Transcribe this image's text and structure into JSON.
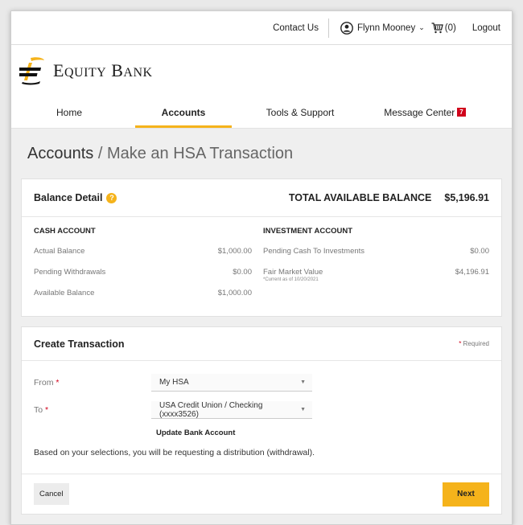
{
  "header": {
    "contact": "Contact Us",
    "user_name": "Flynn Mooney",
    "cart_count": "(0)",
    "logout": "Logout"
  },
  "brand": {
    "name_first": "E",
    "name_first_rest": "QUITY",
    "name_second": "B",
    "name_second_rest": "ANK"
  },
  "nav": {
    "items": [
      {
        "label": "Home"
      },
      {
        "label": "Accounts"
      },
      {
        "label": "Tools & Support"
      },
      {
        "label": "Message Center"
      }
    ],
    "message_badge": "7"
  },
  "page": {
    "title_main": "Accounts",
    "title_sep": " / ",
    "title_sub": "Make an HSA Transaction"
  },
  "balance": {
    "title": "Balance Detail",
    "total_label": "TOTAL AVAILABLE BALANCE",
    "total_value": "$5,196.91",
    "cash": {
      "title": "CASH ACCOUNT",
      "rows": [
        {
          "label": "Actual Balance",
          "value": "$1,000.00"
        },
        {
          "label": "Pending Withdrawals",
          "value": "$0.00"
        },
        {
          "label": "Available Balance",
          "value": "$1,000.00"
        }
      ]
    },
    "investment": {
      "title": "INVESTMENT ACCOUNT",
      "rows": [
        {
          "label": "Pending Cash To Investments",
          "value": "$0.00"
        },
        {
          "label": "Fair Market Value",
          "note": "*Current as of 10/20/2021",
          "value": "$4,196.91"
        }
      ]
    }
  },
  "transaction": {
    "title": "Create Transaction",
    "required": "Required",
    "from_label": "From",
    "from_value": "My HSA",
    "to_label": "To",
    "to_value": "USA Credit Union / Checking (xxxx3526)",
    "update_link": "Update Bank Account",
    "info": "Based on your selections, you will be requesting a distribution (withdrawal).",
    "cancel": "Cancel",
    "next": "Next"
  },
  "colors": {
    "accent": "#f5b31b",
    "badge": "#d0021b"
  }
}
